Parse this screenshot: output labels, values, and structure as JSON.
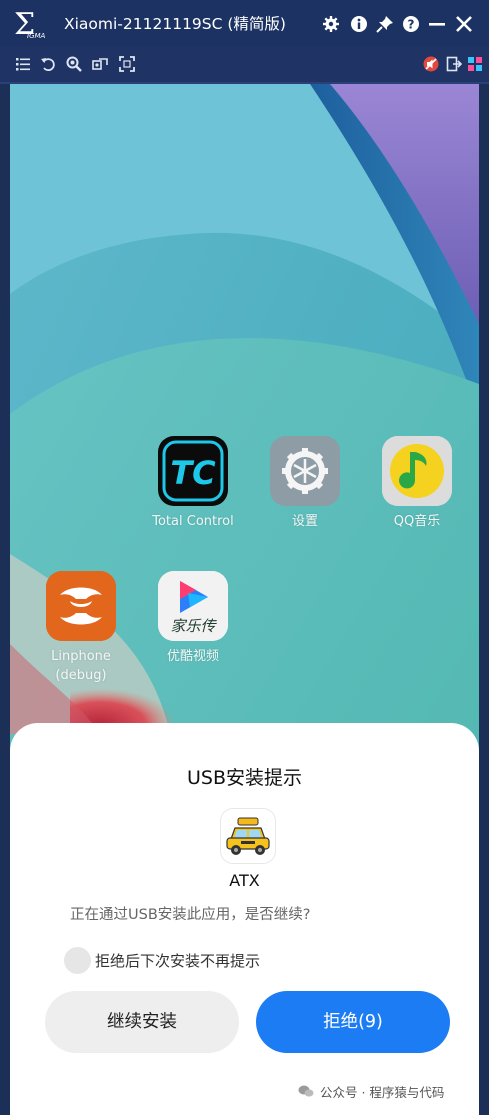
{
  "window": {
    "title": "Xiaomi-21121119SC (精简版)",
    "logo_icon": "sigma-logo",
    "controls": [
      "settings-icon",
      "info-icon",
      "pin-icon",
      "help-icon",
      "minimize-icon",
      "close-icon"
    ]
  },
  "toolbar": {
    "left_tools": [
      "menu-icon",
      "rotate-icon",
      "zoom-icon",
      "screenshot-icon",
      "fullscreen-icon"
    ],
    "right_tools": [
      "no-sound-icon",
      "export-icon",
      "grid-icon"
    ]
  },
  "home": {
    "apps": [
      {
        "label": "Total Control",
        "icon": "total-control-icon"
      },
      {
        "label": "设置",
        "icon": "settings-gear-icon"
      },
      {
        "label": "QQ音乐",
        "icon": "qq-music-icon"
      },
      {
        "label": "Linphone\n(debug)",
        "icon": "linphone-icon"
      },
      {
        "label": "优酷视频",
        "icon": "youku-icon"
      }
    ],
    "youku_icon_text": "家乐传",
    "tc_icon_text": "TC"
  },
  "dialog": {
    "title": "USB安装提示",
    "app_name": "ATX",
    "message": "正在通过USB安装此应用，是否继续?",
    "checkbox_label": "拒绝后下次安装不再提示",
    "continue_label": "继续安装",
    "reject_label": "拒绝(9)"
  },
  "watermark": "公众号 · 程序猿与代码",
  "colors": {
    "titlebar": "#1c3263",
    "reject_button": "#1c7cf3",
    "continue_button": "#eeeeef"
  }
}
